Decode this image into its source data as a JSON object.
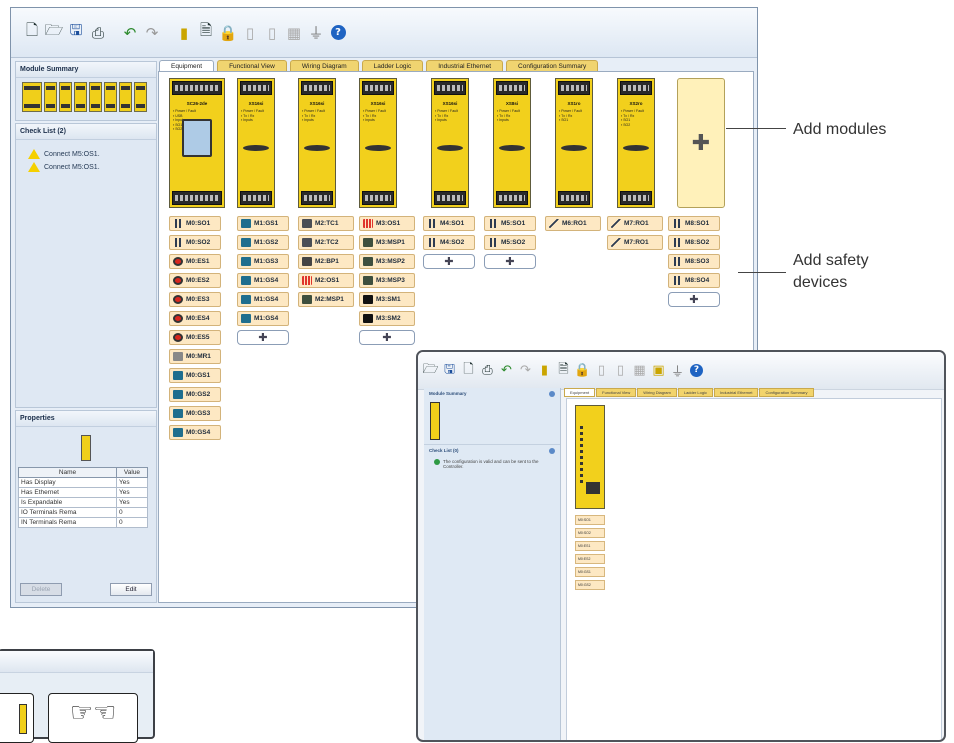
{
  "toolbar": {
    "icons": [
      "new-file-icon",
      "open-folder-icon",
      "save-icon",
      "print-icon",
      "undo-icon",
      "redo-icon",
      "module-icon",
      "report-icon",
      "lock-icon",
      "module-gray-icon",
      "module-gray2-icon",
      "monitor-icon",
      "plug-icon",
      "help-icon"
    ]
  },
  "sidebar": {
    "module_summary": {
      "title": "Module Summary"
    },
    "checklist": {
      "title": "Check List (2)",
      "items": [
        {
          "text": "Connect M5:OS1."
        },
        {
          "text": "Connect M5:OS1."
        }
      ]
    },
    "properties": {
      "title": "Properties",
      "headers": [
        "Name",
        "Value"
      ],
      "rows": [
        {
          "name": "Has Display",
          "value": "Yes"
        },
        {
          "name": "Has Ethernet",
          "value": "Yes"
        },
        {
          "name": "Is Expandable",
          "value": "Yes"
        },
        {
          "name": "IO Terminals Rema",
          "value": "0"
        },
        {
          "name": "IN Terminals Rema",
          "value": "0"
        }
      ],
      "delete_label": "Delete",
      "edit_label": "Edit"
    }
  },
  "tabs": [
    {
      "label": "Equipment",
      "active": true
    },
    {
      "label": "Functional View",
      "active": false
    },
    {
      "label": "Wiring Diagram",
      "active": false
    },
    {
      "label": "Ladder Logic",
      "active": false
    },
    {
      "label": "Industrial Ethernet",
      "active": false
    },
    {
      "label": "Configuration Summary",
      "active": false
    }
  ],
  "modules": [
    {
      "name": "SC26-2de"
    },
    {
      "name": "XS16si"
    },
    {
      "name": "XS16si"
    },
    {
      "name": "XS16si"
    },
    {
      "name": "XS16si"
    },
    {
      "name": "XS8si"
    },
    {
      "name": "XS1ro"
    },
    {
      "name": "XS2ro"
    }
  ],
  "device_columns": [
    {
      "devices": [
        {
          "label": "M0:SO1",
          "icon": "so"
        },
        {
          "label": "M0:SO2",
          "icon": "so"
        },
        {
          "label": "M0:ES1",
          "icon": "es"
        },
        {
          "label": "M0:ES2",
          "icon": "es"
        },
        {
          "label": "M0:ES3",
          "icon": "es"
        },
        {
          "label": "M0:ES4",
          "icon": "es"
        },
        {
          "label": "M0:ES5",
          "icon": "es"
        },
        {
          "label": "M0:MR1",
          "icon": "mr"
        },
        {
          "label": "M0:GS1",
          "icon": "gs"
        },
        {
          "label": "M0:GS2",
          "icon": "gs"
        },
        {
          "label": "M0:GS3",
          "icon": "gs"
        },
        {
          "label": "M0:GS4",
          "icon": "gs"
        }
      ],
      "add": false
    },
    {
      "devices": [
        {
          "label": "M1:GS1",
          "icon": "gs"
        },
        {
          "label": "M1:GS2",
          "icon": "gs"
        },
        {
          "label": "M1:GS3",
          "icon": "gs"
        },
        {
          "label": "M1:GS4",
          "icon": "gs"
        },
        {
          "label": "M1:GS4",
          "icon": "gs"
        },
        {
          "label": "M1:GS4",
          "icon": "gs"
        }
      ],
      "add": true
    },
    {
      "devices": [
        {
          "label": "M2:TC1",
          "icon": "tc"
        },
        {
          "label": "M2:TC2",
          "icon": "tc"
        },
        {
          "label": "M2:BP1",
          "icon": "bp"
        },
        {
          "label": "M2:OS1",
          "icon": "os"
        },
        {
          "label": "M2:MSP1",
          "icon": "msp"
        }
      ],
      "add": false
    },
    {
      "devices": [
        {
          "label": "M3:OS1",
          "icon": "os"
        },
        {
          "label": "M3:MSP1",
          "icon": "msp"
        },
        {
          "label": "M3:MSP2",
          "icon": "msp"
        },
        {
          "label": "M3:MSP3",
          "icon": "msp"
        },
        {
          "label": "M3:SM1",
          "icon": "sm"
        },
        {
          "label": "M3:SM2",
          "icon": "sm"
        }
      ],
      "add": true
    },
    {
      "devices": [
        {
          "label": "M4:SO1",
          "icon": "so"
        },
        {
          "label": "M4:SO2",
          "icon": "so"
        }
      ],
      "add": true
    },
    {
      "devices": [
        {
          "label": "M5:SO1",
          "icon": "so"
        },
        {
          "label": "M5:SO2",
          "icon": "so"
        }
      ],
      "add": true
    },
    {
      "devices": [
        {
          "label": "M6:RO1",
          "icon": "ro"
        }
      ],
      "add": false
    },
    {
      "devices": [
        {
          "label": "M7:RO1",
          "icon": "ro"
        },
        {
          "label": "M7:RO1",
          "icon": "ro"
        }
      ],
      "add": false
    },
    {
      "devices": [
        {
          "label": "M8:SO1",
          "icon": "so"
        },
        {
          "label": "M8:SO2",
          "icon": "so"
        },
        {
          "label": "M8:SO3",
          "icon": "so"
        },
        {
          "label": "M8:SO4",
          "icon": "so"
        }
      ],
      "add": true
    }
  ],
  "callouts": {
    "add_modules": "Add modules",
    "add_safety_devices_line1": "Add safety",
    "add_safety_devices_line2": "devices"
  },
  "inset": {
    "module_summary": "Module Summary",
    "checklist_title": "Check List (0)",
    "checklist_item": "The configuration is valid and can be sent to the Controller.",
    "tabs": [
      "Equipment",
      "Functional View",
      "Wiring Diagram",
      "Ladder Logic",
      "Industrial Ethernet",
      "Configuration Summary"
    ],
    "devices": [
      "M0:SO1",
      "M0:SO2",
      "M0:ES1",
      "M0:ES2",
      "M0:GS1",
      "M0:GS2"
    ]
  }
}
